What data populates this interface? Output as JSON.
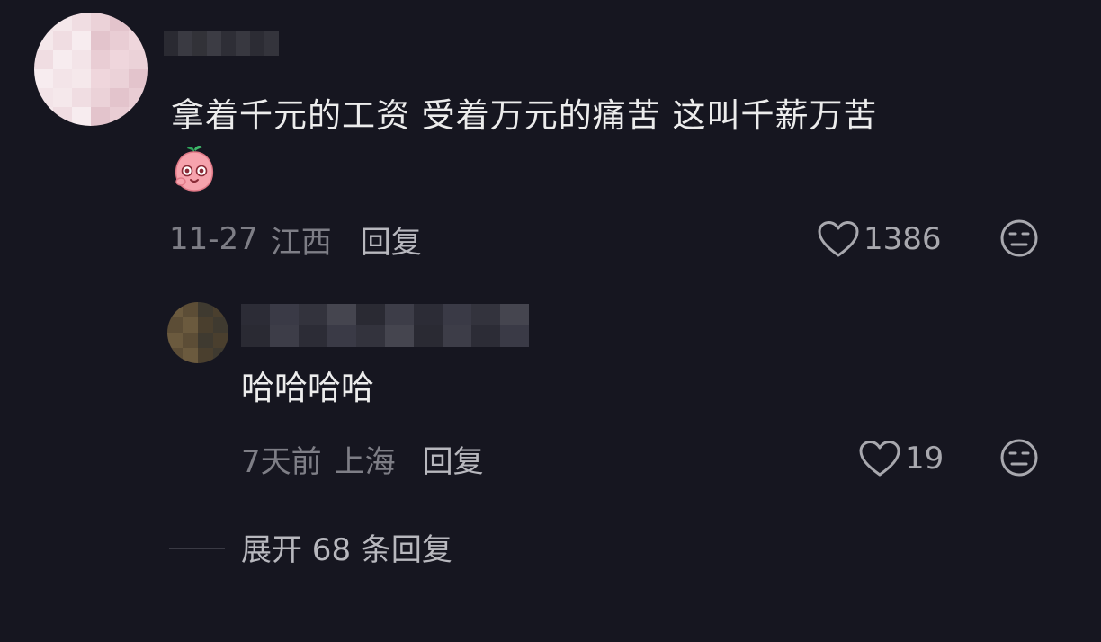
{
  "colors": {
    "background": "#161620",
    "primary_text": "#ececec",
    "secondary_text": "#7e7e86",
    "action_text": "#b8b8be"
  },
  "comment": {
    "text": "拿着千元的工资 受着万元的痛苦 这叫千薪万苦",
    "emoji": "peach-face-emoji",
    "date": "11-27",
    "location": "江西",
    "reply_label": "回复",
    "like_count": "1386",
    "like_icon": "heart-outline-icon",
    "dislike_icon": "neutral-face-icon"
  },
  "reply": {
    "text": "哈哈哈哈",
    "date": "7天前",
    "location": "上海",
    "reply_label": "回复",
    "like_count": "19",
    "like_icon": "heart-outline-icon",
    "dislike_icon": "neutral-face-icon"
  },
  "expand": {
    "label": "展开 68 条回复"
  }
}
